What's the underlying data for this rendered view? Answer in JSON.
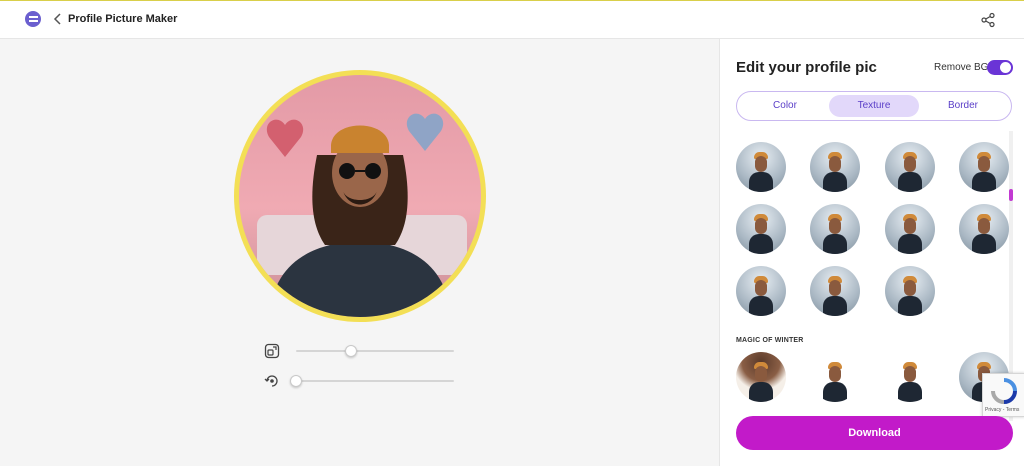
{
  "header": {
    "title": "Profile Picture Maker"
  },
  "panel": {
    "title": "Edit your profile pic",
    "remove_bg_label": "Remove BG",
    "remove_bg_enabled": true,
    "tabs": [
      {
        "label": "Color",
        "active": false
      },
      {
        "label": "Texture",
        "active": true
      },
      {
        "label": "Border",
        "active": false
      }
    ],
    "section_label": "MAGIC OF WINTER",
    "download_label": "Download"
  },
  "sliders": {
    "size_value": 0.35,
    "rotate_value": 0.0
  },
  "recaptcha": {
    "links": "Privacy - Terms"
  },
  "colors": {
    "accent": "#c21ac9",
    "toggle": "#6a34d6",
    "tab_active_bg": "#e2d8fa",
    "avatar_border": "#f3df55"
  }
}
